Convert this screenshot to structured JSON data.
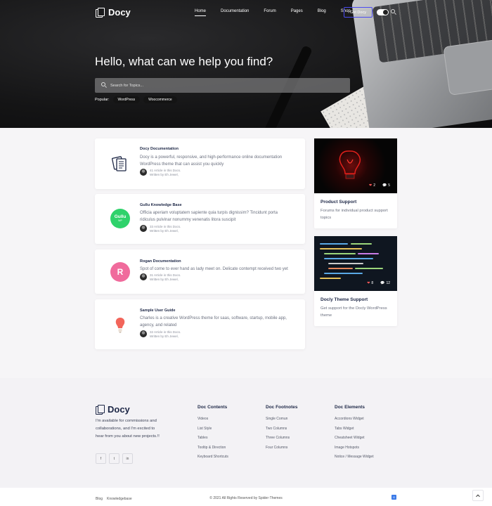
{
  "brand": {
    "name": "Docy"
  },
  "nav": {
    "items": [
      {
        "label": "Home",
        "active": true
      },
      {
        "label": "Documentation"
      },
      {
        "label": "Forum"
      },
      {
        "label": "Pages"
      },
      {
        "label": "Blog"
      },
      {
        "label": "Shop"
      }
    ],
    "cta_label": "Get Docy"
  },
  "hero": {
    "title": "Hello, what can we help you find?",
    "search_placeholder": "Search for Topics...",
    "popular_label": "Popular:",
    "popular_tags": [
      "WordPress",
      "Woocommerce"
    ]
  },
  "docs": [
    {
      "icon": "documents-icon",
      "title": "Docy Documentation",
      "description": "Docy is a powerful, responsive, and high-performance online documentation WordPress theme that can assist you quickly",
      "articles": "41 Article in this Docs.",
      "author": "Written by Eh Jewel,"
    },
    {
      "icon": "gullu-logo-icon",
      "logo_text": "Gullu",
      "logo_sub": "WP",
      "title": "Gullu Knowledge Base",
      "description": "Officia aperiam voluptatem sapiente quia turpis dignissim? Tincidunt porta ridiculus pulvinar nonummy venenatis litora suscipit",
      "articles": "33 Article in this Docs.",
      "author": "Written by Eh Jewel,"
    },
    {
      "icon": "rogan-logo-icon",
      "logo_text": "R",
      "title": "Rogan Documentation",
      "description": "Spot of come to ever hand as lady meet on. Delicate contempt received two yet",
      "articles": "31 Article in this Docs.",
      "author": "Written by Eh Jewel,"
    },
    {
      "icon": "lightbulb-icon",
      "title": "Sample User Guide",
      "description": "Charles is a creative WordPress theme for saas, software, startup, mobile app, agency, and related",
      "articles": "32 Article in this Docs.",
      "author": "Written by Eh Jewel,"
    }
  ],
  "forums": [
    {
      "title": "Product Support",
      "description": "Forums for individual product support topics",
      "likes": "2",
      "replies": "5"
    },
    {
      "title": "Docly Theme Support",
      "description": "Get support for the Docly WordPress theme",
      "likes": "8",
      "replies": "12"
    }
  ],
  "footer": {
    "about": "I'm available for commissions and collaborations, and I'm excited to hear from you about new projects.!!",
    "socials": [
      "f",
      "t",
      "in"
    ],
    "columns": [
      {
        "heading": "Doc Contents",
        "links": [
          "Videos",
          "List Style",
          "Tables",
          "Tooltip & Direction",
          "Keyboard Shortcuts"
        ]
      },
      {
        "heading": "Doc Footnotes",
        "links": [
          "Single Comun",
          "Two Columns",
          "Three Columns",
          "Four Columns"
        ]
      },
      {
        "heading": "Doc Elements",
        "links": [
          "Accordions Widget",
          "Tabs Widget",
          "Cheatsheet Widget",
          "Image Hotspots",
          "Notice / Message Widget"
        ]
      }
    ],
    "bottom_links": [
      "Blog",
      "Knowledgebase"
    ],
    "copyright": "© 2021 All Rights Reserved by Spider-Themes"
  }
}
